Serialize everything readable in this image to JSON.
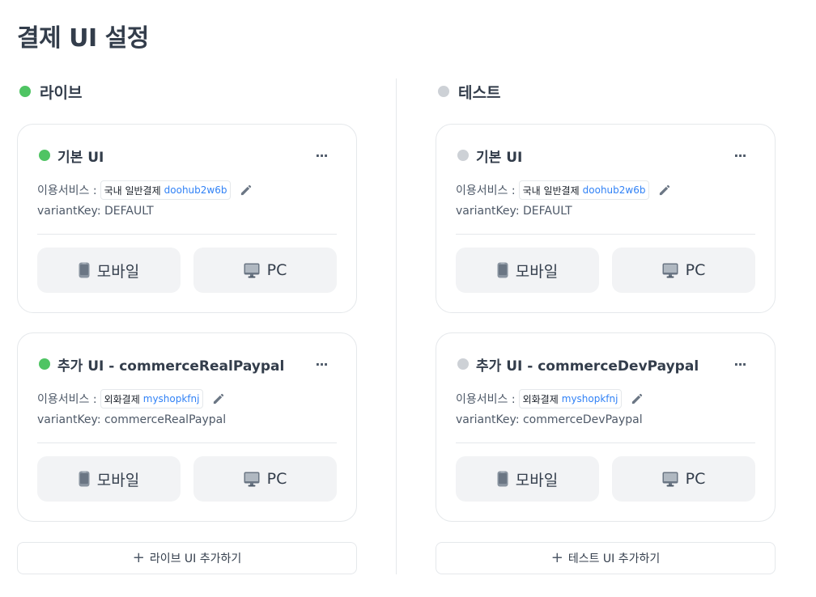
{
  "page": {
    "title": "결제 UI 설정"
  },
  "colors": {
    "live_dot": "#4fc463",
    "test_dot": "#cdd1d6",
    "link": "#3182f6"
  },
  "live": {
    "title": "라이브",
    "cards": [
      {
        "title": "기본 UI",
        "service_label": "이용서비스 :",
        "service_name": "국내 일반결제",
        "service_id": "doohub2w6b",
        "variant": "variantKey: DEFAULT",
        "mobile_label": "모바일",
        "pc_label": "PC",
        "more": "···"
      },
      {
        "title": "추가 UI - commerceRealPaypal",
        "service_label": "이용서비스 :",
        "service_name": "외화결제",
        "service_id": "myshopkfnj",
        "variant": "variantKey: commerceRealPaypal",
        "mobile_label": "모바일",
        "pc_label": "PC",
        "more": "···"
      }
    ],
    "add_button": "라이브 UI 추가하기"
  },
  "test": {
    "title": "테스트",
    "cards": [
      {
        "title": "기본 UI",
        "service_label": "이용서비스 :",
        "service_name": "국내 일반결제",
        "service_id": "doohub2w6b",
        "variant": "variantKey: DEFAULT",
        "mobile_label": "모바일",
        "pc_label": "PC",
        "more": "···"
      },
      {
        "title": "추가 UI - commerceDevPaypal",
        "service_label": "이용서비스 :",
        "service_name": "외화결제",
        "service_id": "myshopkfnj",
        "variant": "variantKey: commerceDevPaypal",
        "mobile_label": "모바일",
        "pc_label": "PC",
        "more": "···"
      }
    ],
    "add_button": "테스트 UI 추가하기"
  },
  "icons": {
    "status": "status-dot-icon",
    "more": "more-horizontal-icon",
    "edit": "pencil-icon",
    "mobile": "mobile-phone-icon",
    "pc": "desktop-monitor-icon",
    "add": "plus-icon"
  }
}
